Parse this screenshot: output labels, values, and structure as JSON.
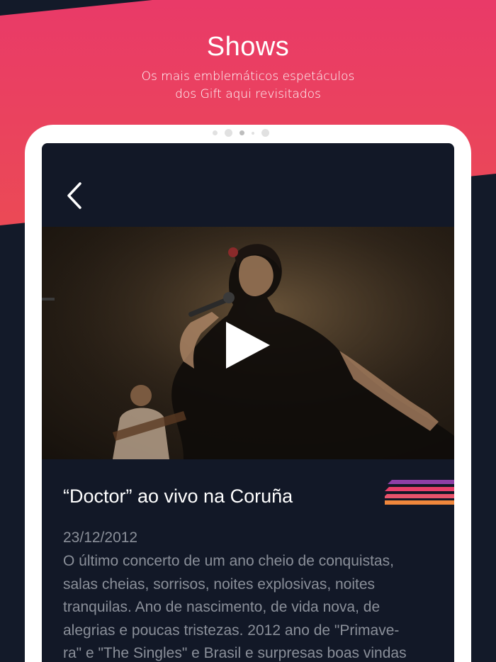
{
  "header": {
    "title": "Shows",
    "subtitle_line1": "Os mais emblemáticos espetáculos",
    "subtitle_line2": "dos Gift aqui revisitados"
  },
  "colors": {
    "gradient_top": "#e93a68",
    "gradient_bottom": "#ee5b44",
    "background": "#131a29",
    "screen": "#121827",
    "stripe_purple": "#8e3fa6",
    "stripe_pink": "#e83f6a",
    "stripe_orange": "#f0873c"
  },
  "screen": {
    "back_icon": "chevron-left-icon",
    "video": {
      "play_icon": "play-icon"
    },
    "show": {
      "title": "“Doctor” ao vivo na Coruña",
      "date": "23/12/2012",
      "description": [
        "O último concerto de um ano cheio de conquistas,",
        "salas cheias, sorrisos, noites explosivas, noites",
        "tranquilas. Ano de nascimento, de vida nova, de",
        "alegrias e poucas tristezas. 2012 ano de \"Primave-",
        "ra\" e \"The Singles\" e Brasil e surpresas boas vindas"
      ]
    }
  }
}
